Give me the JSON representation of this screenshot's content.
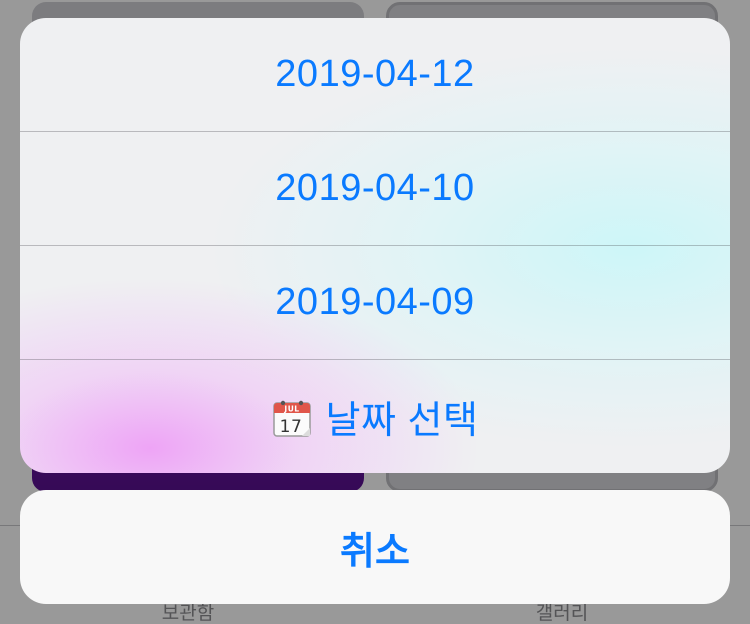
{
  "background": {
    "tabs": [
      "보관함",
      "갤러리"
    ]
  },
  "action_sheet": {
    "options": [
      {
        "label": "2019-04-12"
      },
      {
        "label": "2019-04-10"
      },
      {
        "label": "2019-04-09"
      }
    ],
    "date_picker": {
      "icon": "calendar-icon",
      "icon_month": "JUL",
      "icon_day": "17",
      "label": "날짜 선택"
    },
    "cancel_label": "취소"
  },
  "colors": {
    "accent": "#0a7aff",
    "sheet_background": "#eff0f2",
    "cancel_background": "#f8f8f8",
    "calendar_header": "#e0564a"
  }
}
